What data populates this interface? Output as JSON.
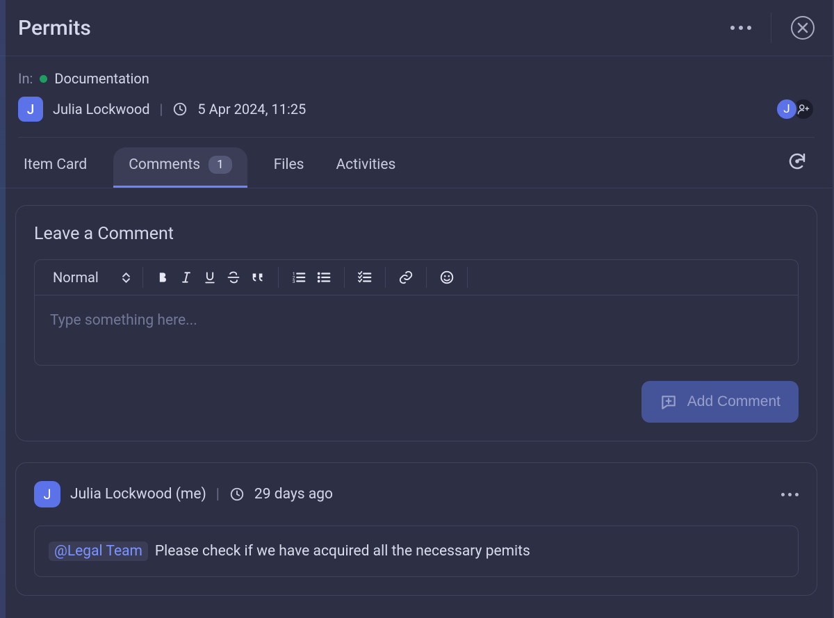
{
  "header": {
    "title": "Permits"
  },
  "meta": {
    "in_label": "In:",
    "category": "Documentation",
    "author": {
      "initial": "J",
      "name": "Julia Lockwood"
    },
    "timestamp": "5 Apr 2024, 11:25",
    "participants": {
      "avatar_initial": "J"
    }
  },
  "tabs": {
    "item_card": "Item Card",
    "comments": "Comments",
    "comments_count": "1",
    "files": "Files",
    "activities": "Activities"
  },
  "composer": {
    "title": "Leave a Comment",
    "format_label": "Normal",
    "placeholder": "Type something here...",
    "submit_label": "Add Comment"
  },
  "comment": {
    "author_initial": "J",
    "author": "Julia Lockwood (me)",
    "relative_time": "29 days ago",
    "mention": "@Legal Team",
    "text": "Please check if we have acquired all the necessary pemits"
  }
}
